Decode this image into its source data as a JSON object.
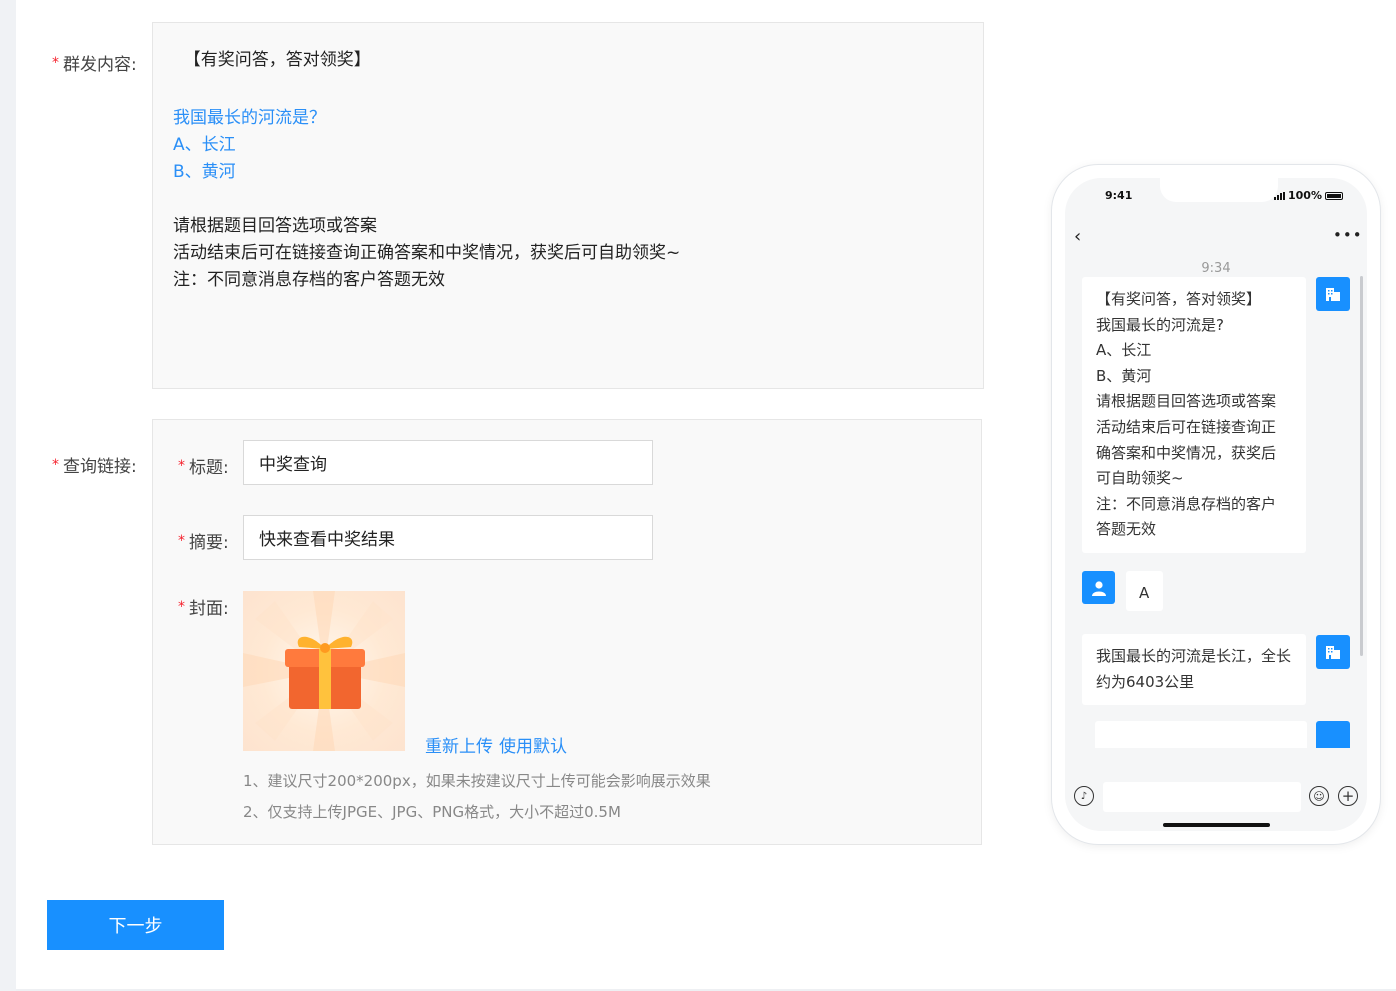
{
  "form": {
    "content_label": "群发内容:",
    "content_lines": [
      {
        "text": "  【有奖问答，答对领奖】",
        "color": "dark"
      },
      {
        "text": "",
        "color": "dark"
      },
      {
        "text": "我国最长的河流是？",
        "color": "blue"
      },
      {
        "text": "A、长江",
        "color": "blue"
      },
      {
        "text": "B、黄河",
        "color": "blue"
      },
      {
        "text": "",
        "color": "dark"
      },
      {
        "text": "请根据题目回答选项或答案",
        "color": "dark"
      },
      {
        "text": "活动结束后可在链接查询正确答案和中奖情况，获奖后可自助领奖~",
        "color": "dark"
      },
      {
        "text": "注：不同意消息存档的客户答题无效",
        "color": "dark"
      }
    ],
    "link_label": "查询链接:",
    "title_label": "标题:",
    "title_value": "中奖查询",
    "summary_label": "摘要:",
    "summary_value": "快来查看中奖结果",
    "cover_label": "封面:",
    "reupload": "重新上传",
    "use_default": "使用默认",
    "hint1": "1、建议尺寸200*200px，如果未按建议尺寸上传可能会影响展示效果",
    "hint2": "2、仅支持上传JPGE、JPG、PNG格式，大小不超过0.5M",
    "next_button": "下一步"
  },
  "phone": {
    "status_time": "9:41",
    "battery": "100%",
    "chat_time": "9:34",
    "message1_lines": [
      "【有奖问答，答对领奖】",
      "我国最长的河流是?",
      "A、长江",
      "B、黄河",
      "请根据题目回答选项或答案",
      "活动结束后可在链接查询正",
      "确答案和中奖情况，获奖后",
      "可自助领奖~",
      "注：不同意消息存档的客户",
      "答题无效"
    ],
    "reply": "A",
    "message2_lines": [
      "我国最长的河流是长江，全长",
      "约为6403公里"
    ]
  },
  "colors": {
    "accent": "#1890ff",
    "link_blue": "#2a8ff7",
    "required": "#f5222d"
  }
}
